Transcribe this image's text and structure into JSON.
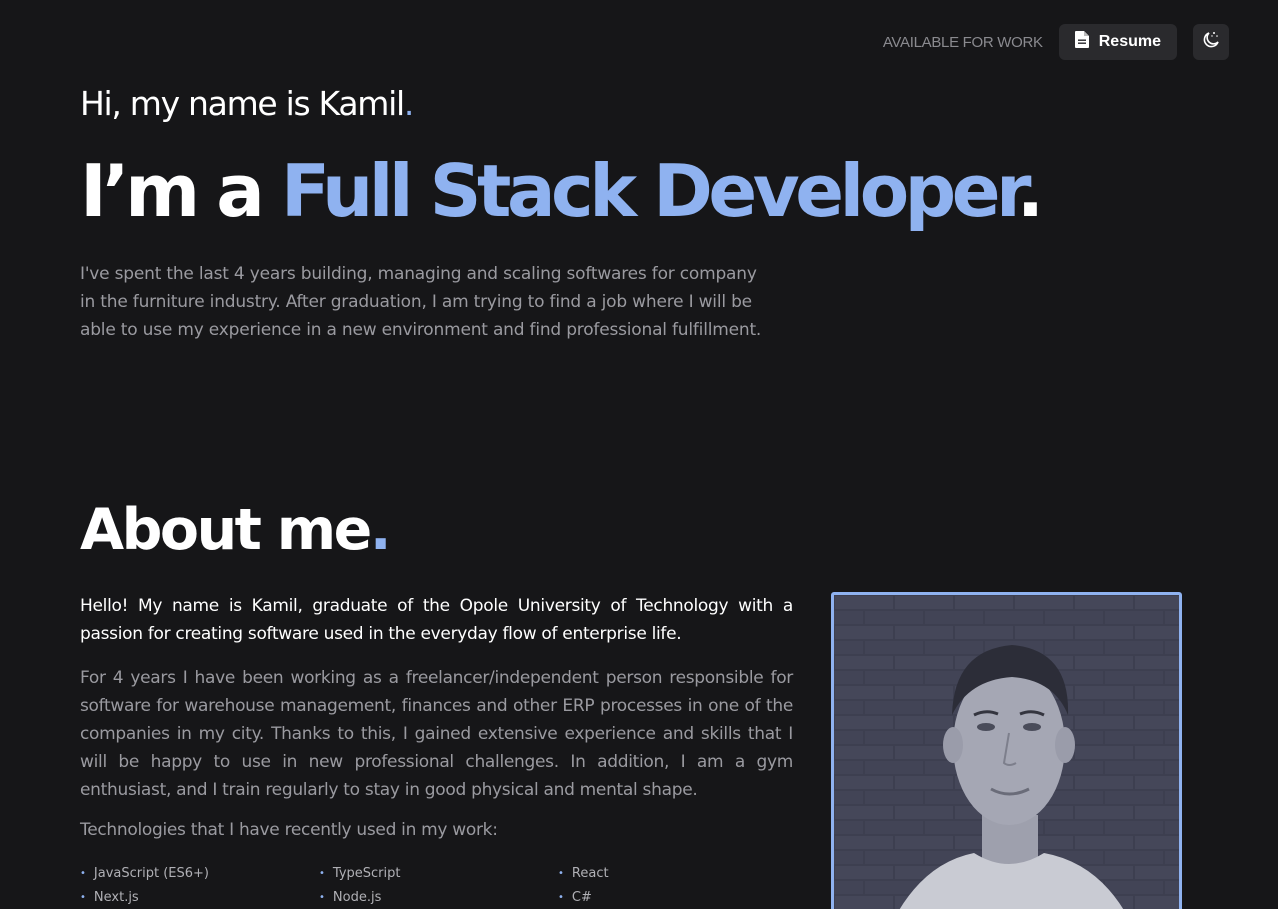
{
  "header": {
    "availability": "AVAILABLE FOR WORK",
    "resume_label": "Resume",
    "icons": {
      "resume": "document-icon",
      "theme": "moon-stars-icon"
    }
  },
  "hero": {
    "greeting": "Hi, my name is Kamil",
    "title_prefix": "I’m a ",
    "title_accent": "Full Stack Developer",
    "description": "I've spent the last 4 years building, managing and scaling softwares for company in the furniture industry. After graduation, I am trying to find a job where I will be able to use my experience in a new environment and find professional fulfillment."
  },
  "about": {
    "title": "About me",
    "lead": "Hello! My name is Kamil, graduate of the Opole University of Technology with a passion for creating software used in the everyday flow of enterprise life.",
    "body": "For 4 years I have been working as a freelancer/independent person responsible for software for warehouse management, finances and other ERP processes in one of the companies in my city. Thanks to this, I gained extensive experience and skills that I will be happy to use in new professional challenges. In addition, I am a gym enthusiast, and I train regularly to stay in good physical and mental shape.",
    "tech_intro": "Technologies that I have recently used in my work:",
    "technologies": [
      "JavaScript (ES6+)",
      "TypeScript",
      "React",
      "Next.js",
      "Node.js",
      "C#"
    ]
  },
  "colors": {
    "background": "#161618",
    "accent": "#8fb2f0",
    "muted_text": "#9a9aa0",
    "button_bg": "#2a2a2d"
  }
}
